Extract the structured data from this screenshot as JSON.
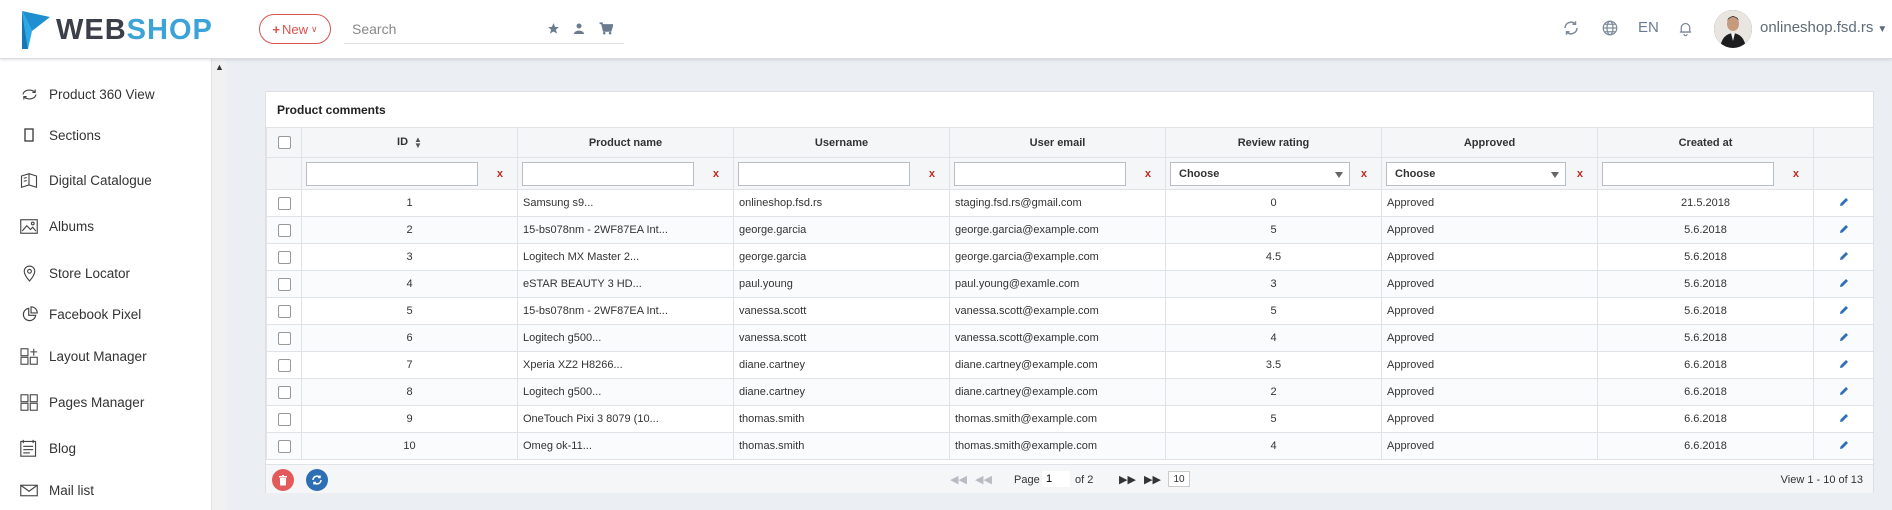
{
  "header": {
    "logo_web": "WEB",
    "logo_shop": "SHOP",
    "new_label": "New",
    "search_placeholder": "Search",
    "lang": "EN",
    "domain": "onlineshop.fsd.rs"
  },
  "sidebar": {
    "items": [
      {
        "label": "Product 360 View",
        "icon": "rotate-360-icon"
      },
      {
        "label": "Sections",
        "icon": "sections-icon"
      },
      {
        "label": "Digital Catalogue",
        "icon": "catalogue-icon"
      },
      {
        "label": "Albums",
        "icon": "image-icon"
      },
      {
        "label": "Store Locator",
        "icon": "location-icon"
      },
      {
        "label": "Facebook Pixel",
        "icon": "pie-chart-icon"
      },
      {
        "label": "Layout Manager",
        "icon": "layout-icon"
      },
      {
        "label": "Pages Manager",
        "icon": "pages-icon"
      },
      {
        "label": "Blog",
        "icon": "blog-icon"
      },
      {
        "label": "Mail list",
        "icon": "mail-icon"
      }
    ]
  },
  "panel": {
    "title": "Product comments",
    "columns": [
      "ID",
      "Product name",
      "Username",
      "User email",
      "Review rating",
      "Approved",
      "Created at"
    ],
    "filter_choose": "Choose",
    "filter_clear": "x",
    "rows": [
      {
        "id": "1",
        "product": "Samsung s9...",
        "username": "onlineshop.fsd.rs",
        "email": "staging.fsd.rs@gmail.com",
        "rating": "0",
        "approved": "Approved",
        "created": "21.5.2018"
      },
      {
        "id": "2",
        "product": "15-bs078nm - 2WF87EA Int...",
        "username": "george.garcia",
        "email": "george.garcia@example.com",
        "rating": "5",
        "approved": "Approved",
        "created": "5.6.2018"
      },
      {
        "id": "3",
        "product": "Logitech MX Master 2...",
        "username": "george.garcia",
        "email": "george.garcia@example.com",
        "rating": "4.5",
        "approved": "Approved",
        "created": "5.6.2018"
      },
      {
        "id": "4",
        "product": "eSTAR BEAUTY 3 HD...",
        "username": "paul.young",
        "email": "paul.young@examle.com",
        "rating": "3",
        "approved": "Approved",
        "created": "5.6.2018"
      },
      {
        "id": "5",
        "product": "15-bs078nm - 2WF87EA Int...",
        "username": "vanessa.scott",
        "email": "vanessa.scott@example.com",
        "rating": "5",
        "approved": "Approved",
        "created": "5.6.2018"
      },
      {
        "id": "6",
        "product": "Logitech g500...",
        "username": "vanessa.scott",
        "email": "vanessa.scott@example.com",
        "rating": "4",
        "approved": "Approved",
        "created": "5.6.2018"
      },
      {
        "id": "7",
        "product": "Xperia XZ2 H8266...",
        "username": "diane.cartney",
        "email": "diane.cartney@example.com",
        "rating": "3.5",
        "approved": "Approved",
        "created": "6.6.2018"
      },
      {
        "id": "8",
        "product": "Logitech g500...",
        "username": "diane.cartney",
        "email": "diane.cartney@example.com",
        "rating": "2",
        "approved": "Approved",
        "created": "6.6.2018"
      },
      {
        "id": "9",
        "product": "OneTouch Pixi 3 8079 (10...",
        "username": "thomas.smith",
        "email": "thomas.smith@example.com",
        "rating": "5",
        "approved": "Approved",
        "created": "6.6.2018"
      },
      {
        "id": "10",
        "product": "Omeg ok-11...",
        "username": "thomas.smith",
        "email": "thomas.smith@example.com",
        "rating": "4",
        "approved": "Approved",
        "created": "6.6.2018"
      }
    ]
  },
  "pager": {
    "page_label": "Page",
    "page_value": "1",
    "of_label": "of 2",
    "page_size": "10",
    "view_info": "View 1 - 10 of 13"
  },
  "colors": {
    "accent_red": "#d9534f",
    "brand_blue": "#3ba3d8",
    "edit_blue": "#2f6fb7"
  }
}
